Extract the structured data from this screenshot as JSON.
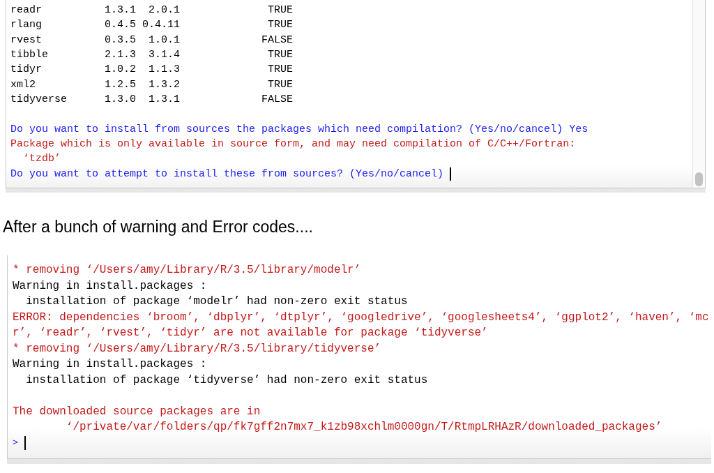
{
  "top_console": {
    "table": {
      "rows": [
        {
          "cells": [
            "readr",
            "1.3.1",
            "2.0.1",
            "TRUE"
          ]
        },
        {
          "cells": [
            "rlang",
            "0.4.5",
            "0.4.11",
            "TRUE"
          ]
        },
        {
          "cells": [
            "rvest",
            "0.3.5",
            "1.0.1",
            "FALSE"
          ]
        },
        {
          "cells": [
            "tibble",
            "2.1.3",
            "3.1.4",
            "TRUE"
          ]
        },
        {
          "cells": [
            "tidyr",
            "1.0.2",
            "1.1.3",
            "TRUE"
          ]
        },
        {
          "cells": [
            "xml2",
            "1.2.5",
            "1.3.2",
            "TRUE"
          ]
        },
        {
          "cells": [
            "tidyverse",
            "1.3.0",
            "1.3.1",
            "FALSE"
          ]
        }
      ]
    },
    "lines": [
      {
        "kind": "input",
        "text": "Do you want to install from sources the packages which need compilation? (Yes/no/cancel) Yes",
        "cursor": false
      },
      {
        "kind": "error",
        "text": "Package which is only available in source form, and may need compilation of C/C++/Fortran:",
        "cursor": false
      },
      {
        "kind": "error_detail",
        "text": "‘tzdb’",
        "cursor": false
      },
      {
        "kind": "input",
        "text": "Do you want to attempt to install these from sources? (Yes/no/cancel)",
        "cursor": true
      }
    ]
  },
  "caption": "After a bunch of warning and Error codes....",
  "bottom_console": {
    "blocks": [
      {
        "lines": [
          {
            "kind": "error",
            "text": "* removing ‘/Users/amy/Library/R/3.5/library/modelr’"
          },
          {
            "kind": "output",
            "text": "Warning in install.packages :"
          },
          {
            "kind": "output_detail",
            "text": "installation of package ‘modelr’ had non-zero exit status"
          },
          {
            "kind": "error",
            "text": "ERROR: dependencies ‘broom’, ‘dbplyr’, ‘dtplyr’, ‘googledrive’, ‘googlesheets4’, ‘ggplot2’, ‘haven’, ‘mc"
          },
          {
            "kind": "error",
            "text": "r’, ‘readr’, ‘rvest’, ‘tidyr’ are not available for package ‘tidyverse’"
          },
          {
            "kind": "error",
            "text": "* removing ‘/Users/amy/Library/R/3.5/library/tidyverse’"
          },
          {
            "kind": "output",
            "text": "Warning in install.packages :"
          },
          {
            "kind": "output_detail",
            "text": "installation of package ‘tidyverse’ had non-zero exit status"
          }
        ]
      },
      {
        "lines": [
          {
            "kind": "error",
            "text": "The downloaded source packages are in"
          },
          {
            "kind": "path",
            "text": "‘/private/var/folders/qp/fk7gff2n7mx7_k1zb98xchlm0000gn/T/RtmpLRHAzR/downloaded_packages’"
          }
        ]
      }
    ],
    "prompt": {
      "symbol": ">",
      "cursor": true
    }
  }
}
